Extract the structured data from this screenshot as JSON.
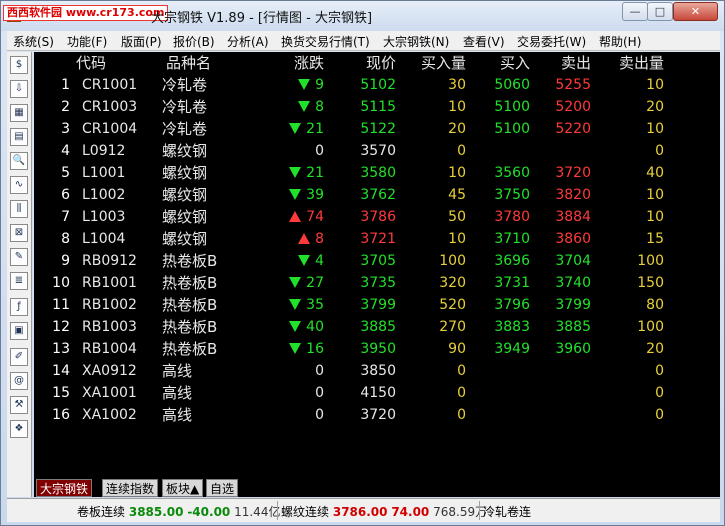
{
  "window": {
    "title": "大宗钢铁 V1.89 - [行情图 - 大宗钢铁]",
    "watermark": "西西软件园 www.cr173.com",
    "minimize": "—",
    "maximize": "□",
    "close": "✕"
  },
  "menu": [
    "系统(S)",
    "功能(F)",
    "版面(P)",
    "报价(B)",
    "分析(A)",
    "换货交易行情(T)",
    "大宗钢铁(N)",
    "查看(V)",
    "交易委托(W)",
    "帮助(H)"
  ],
  "toolbar_icons": [
    "dollar-icon",
    "download-icon",
    "grid-icon",
    "table-icon",
    "search-doc-icon",
    "line-chart-icon",
    "candle-chart-icon",
    "compare-chart-icon",
    "note-icon",
    "news-icon",
    "fx-icon",
    "report-icon",
    "draw-icon",
    "at-icon",
    "tools-icon",
    "book-icon"
  ],
  "toolbar_glyphs": [
    "$",
    "⇩",
    "▦",
    "▤",
    "🔍",
    "∿",
    "⫼",
    "⊠",
    "✎",
    "≣",
    "ƒ",
    "▣",
    "✐",
    "@",
    "⚒",
    "❖"
  ],
  "headers": {
    "code": "代码",
    "name": "品种名",
    "change": "涨跌",
    "price": "现价",
    "bid_vol": "买入量",
    "bid": "买入",
    "ask": "卖出",
    "ask_vol": "卖出量"
  },
  "rows": [
    {
      "idx": "1",
      "code": "CR1001",
      "name": "冷轧卷",
      "dir": "down",
      "chg": "9",
      "price": "5102",
      "bvol": "30",
      "bid": "5060",
      "bid_dir": "down",
      "ask": "5255",
      "ask_dir": "up",
      "avol": "10"
    },
    {
      "idx": "2",
      "code": "CR1003",
      "name": "冷轧卷",
      "dir": "down",
      "chg": "8",
      "price": "5115",
      "bvol": "10",
      "bid": "5100",
      "bid_dir": "down",
      "ask": "5200",
      "ask_dir": "up",
      "avol": "20"
    },
    {
      "idx": "3",
      "code": "CR1004",
      "name": "冷轧卷",
      "dir": "down",
      "chg": "21",
      "price": "5122",
      "bvol": "20",
      "bid": "5100",
      "bid_dir": "down",
      "ask": "5220",
      "ask_dir": "up",
      "avol": "10"
    },
    {
      "idx": "4",
      "code": "L0912",
      "name": "螺纹钢",
      "dir": "flat",
      "chg": "0",
      "price": "3570",
      "bvol": "0",
      "bid": "",
      "bid_dir": "flat",
      "ask": "",
      "ask_dir": "flat",
      "avol": "0"
    },
    {
      "idx": "5",
      "code": "L1001",
      "name": "螺纹钢",
      "dir": "down",
      "chg": "21",
      "price": "3580",
      "bvol": "10",
      "bid": "3560",
      "bid_dir": "down",
      "ask": "3720",
      "ask_dir": "up",
      "avol": "40"
    },
    {
      "idx": "6",
      "code": "L1002",
      "name": "螺纹钢",
      "dir": "down",
      "chg": "39",
      "price": "3762",
      "bvol": "45",
      "bid": "3750",
      "bid_dir": "down",
      "ask": "3820",
      "ask_dir": "up",
      "avol": "10"
    },
    {
      "idx": "7",
      "code": "L1003",
      "name": "螺纹钢",
      "dir": "up",
      "chg": "74",
      "price": "3786",
      "bvol": "50",
      "bid": "3780",
      "bid_dir": "up",
      "ask": "3884",
      "ask_dir": "up",
      "avol": "10"
    },
    {
      "idx": "8",
      "code": "L1004",
      "name": "螺纹钢",
      "dir": "up",
      "chg": "8",
      "price": "3721",
      "bvol": "10",
      "bid": "3710",
      "bid_dir": "down",
      "ask": "3860",
      "ask_dir": "up",
      "avol": "15"
    },
    {
      "idx": "9",
      "code": "RB0912",
      "name": "热卷板B",
      "dir": "down",
      "chg": "4",
      "price": "3705",
      "bvol": "100",
      "bid": "3696",
      "bid_dir": "down",
      "ask": "3704",
      "ask_dir": "down",
      "avol": "100"
    },
    {
      "idx": "10",
      "code": "RB1001",
      "name": "热卷板B",
      "dir": "down",
      "chg": "27",
      "price": "3735",
      "bvol": "320",
      "bid": "3731",
      "bid_dir": "down",
      "ask": "3740",
      "ask_dir": "down",
      "avol": "150"
    },
    {
      "idx": "11",
      "code": "RB1002",
      "name": "热卷板B",
      "dir": "down",
      "chg": "35",
      "price": "3799",
      "bvol": "520",
      "bid": "3796",
      "bid_dir": "down",
      "ask": "3799",
      "ask_dir": "down",
      "avol": "80"
    },
    {
      "idx": "12",
      "code": "RB1003",
      "name": "热卷板B",
      "dir": "down",
      "chg": "40",
      "price": "3885",
      "bvol": "270",
      "bid": "3883",
      "bid_dir": "down",
      "ask": "3885",
      "ask_dir": "down",
      "avol": "100"
    },
    {
      "idx": "13",
      "code": "RB1004",
      "name": "热卷板B",
      "dir": "down",
      "chg": "16",
      "price": "3950",
      "bvol": "90",
      "bid": "3949",
      "bid_dir": "down",
      "ask": "3960",
      "ask_dir": "down",
      "avol": "20"
    },
    {
      "idx": "14",
      "code": "XA0912",
      "name": "高线",
      "dir": "flat",
      "chg": "0",
      "price": "3850",
      "bvol": "0",
      "bid": "",
      "bid_dir": "flat",
      "ask": "",
      "ask_dir": "flat",
      "avol": "0"
    },
    {
      "idx": "15",
      "code": "XA1001",
      "name": "高线",
      "dir": "flat",
      "chg": "0",
      "price": "4150",
      "bvol": "0",
      "bid": "",
      "bid_dir": "flat",
      "ask": "",
      "ask_dir": "flat",
      "avol": "0"
    },
    {
      "idx": "16",
      "code": "XA1002",
      "name": "高线",
      "dir": "flat",
      "chg": "0",
      "price": "3720",
      "bvol": "0",
      "bid": "",
      "bid_dir": "flat",
      "ask": "",
      "ask_dir": "flat",
      "avol": "0"
    }
  ],
  "tabs": [
    "大宗钢铁",
    "连续指数",
    "板块▲",
    "自选"
  ],
  "status": {
    "s1_label": "卷板连续",
    "s1_price": "3885.00",
    "s1_change": "-40.00",
    "s1_amount": "11.44亿",
    "s2_label": "螺纹连续",
    "s2_price": "3786.00",
    "s2_change": "74.00",
    "s2_amount": "768.59万",
    "s3_label": "冷轧卷连"
  },
  "colors": {
    "up": "#ff3a3a",
    "down": "#22e12a",
    "volume": "#e8d03c",
    "grid_bg": "#000000",
    "active_tab": "#800000"
  }
}
